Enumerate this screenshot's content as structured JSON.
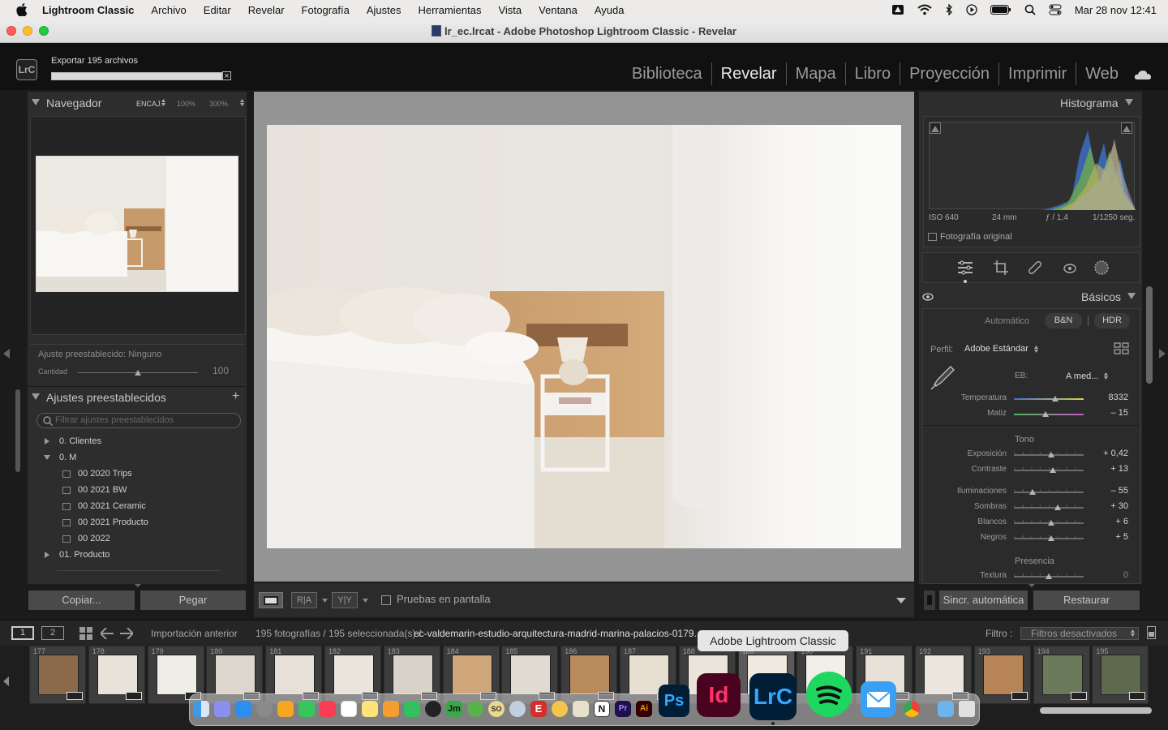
{
  "menubar": {
    "app_name": "Lightroom Classic",
    "items": [
      "Archivo",
      "Editar",
      "Revelar",
      "Fotografía",
      "Ajustes",
      "Herramientas",
      "Vista",
      "Ventana",
      "Ayuda"
    ],
    "clock": "Mar 28 nov  12:41"
  },
  "window": {
    "title": "lr_ec.lrcat - Adobe Photoshop Lightroom Classic - Revelar"
  },
  "identity": {
    "logo": "LrC"
  },
  "export": {
    "label": "Exportar 195 archivos",
    "progress": 1.0
  },
  "modules": [
    "Biblioteca",
    "Revelar",
    "Mapa",
    "Libro",
    "Proyección",
    "Imprimir",
    "Web"
  ],
  "active_module": "Revelar",
  "navigator": {
    "title": "Navegador",
    "zoom_fit": "ENCAJ.",
    "zoom_100": "100%",
    "zoom_300": "300%"
  },
  "preset_amount": {
    "label": "Ajuste preestablecido: Ninguno",
    "amount_label": "Cantidad",
    "amount_value": "100",
    "amount_level": 1.0
  },
  "presets": {
    "title": "Ajustes preestablecidos",
    "search_placeholder": "Filtrar ajustes preestablecidos",
    "items": [
      {
        "label": "0. Clientes"
      },
      {
        "label": "0. M"
      },
      {
        "label": "00 2020 Trips"
      },
      {
        "label": "00 2021 BW"
      },
      {
        "label": "00 2021 Ceramic"
      },
      {
        "label": "00 2021 Producto"
      },
      {
        "label": "00 2022"
      },
      {
        "label": "01. Producto"
      }
    ]
  },
  "left_buttons": {
    "copy": "Copiar...",
    "paste": "Pegar"
  },
  "toolbar": {
    "ra": "R|A",
    "yy": "Y|Y",
    "softproof": "Pruebas en pantalla"
  },
  "histogram": {
    "title": "Histograma",
    "iso": "ISO 640",
    "focal": "24 mm",
    "aperture": "ƒ / 1,4",
    "shutter": "1/1250 seg.",
    "original": "Fotografía original"
  },
  "basic": {
    "title": "Básicos",
    "treatment": {
      "auto": "Automático",
      "bw": "B&N",
      "hdr": "HDR"
    },
    "profile_label": "Perfil:",
    "profile_value": "Adobe Estándar",
    "wb_label": "EB:",
    "wb_value": "A med...",
    "sliders": [
      {
        "label": "Temperatura",
        "value": "8332",
        "pos": 0.59
      },
      {
        "label": "Matiz",
        "value": "– 15",
        "pos": 0.45
      },
      {
        "label": "Exposición",
        "value": "+ 0,42",
        "pos": 0.54
      },
      {
        "label": "Contraste",
        "value": "+ 13",
        "pos": 0.56
      },
      {
        "label": "Iluminaciones",
        "value": "– 55",
        "pos": 0.27
      },
      {
        "label": "Sombras",
        "value": "+ 30",
        "pos": 0.63
      },
      {
        "label": "Blancos",
        "value": "+ 6",
        "pos": 0.53
      },
      {
        "label": "Negros",
        "value": "+ 5",
        "pos": 0.53
      },
      {
        "label": "Textura",
        "value": "0",
        "pos": 0.5
      }
    ],
    "tone_heading": "Tono",
    "presence_heading": "Presencia"
  },
  "right_buttons": {
    "sync": "Sincr. automática",
    "reset": "Restaurar"
  },
  "filmbar": {
    "screen1": "1",
    "screen2": "2",
    "source": "Importación anterior",
    "count": "195 fotografías / 195 seleccionada(s) /",
    "filename": "ec-valdemarin-estudio-arquitectura-madrid-marina-palacios-0179.",
    "filter_label": "Filtro :",
    "filter_value": "Filtros desactivados"
  },
  "filmstrip": {
    "frames": [
      "177",
      "178",
      "179",
      "180",
      "181",
      "182",
      "183",
      "184",
      "185",
      "186",
      "187",
      "188",
      "189",
      "190",
      "191",
      "192",
      "193",
      "194",
      "195"
    ]
  },
  "dock": {
    "tooltip": "Adobe Lightroom Classic",
    "apps": [
      "Ps",
      "Id",
      "LrC",
      "Jm",
      "SO",
      "E",
      "N",
      "Pr",
      "Ai"
    ]
  }
}
